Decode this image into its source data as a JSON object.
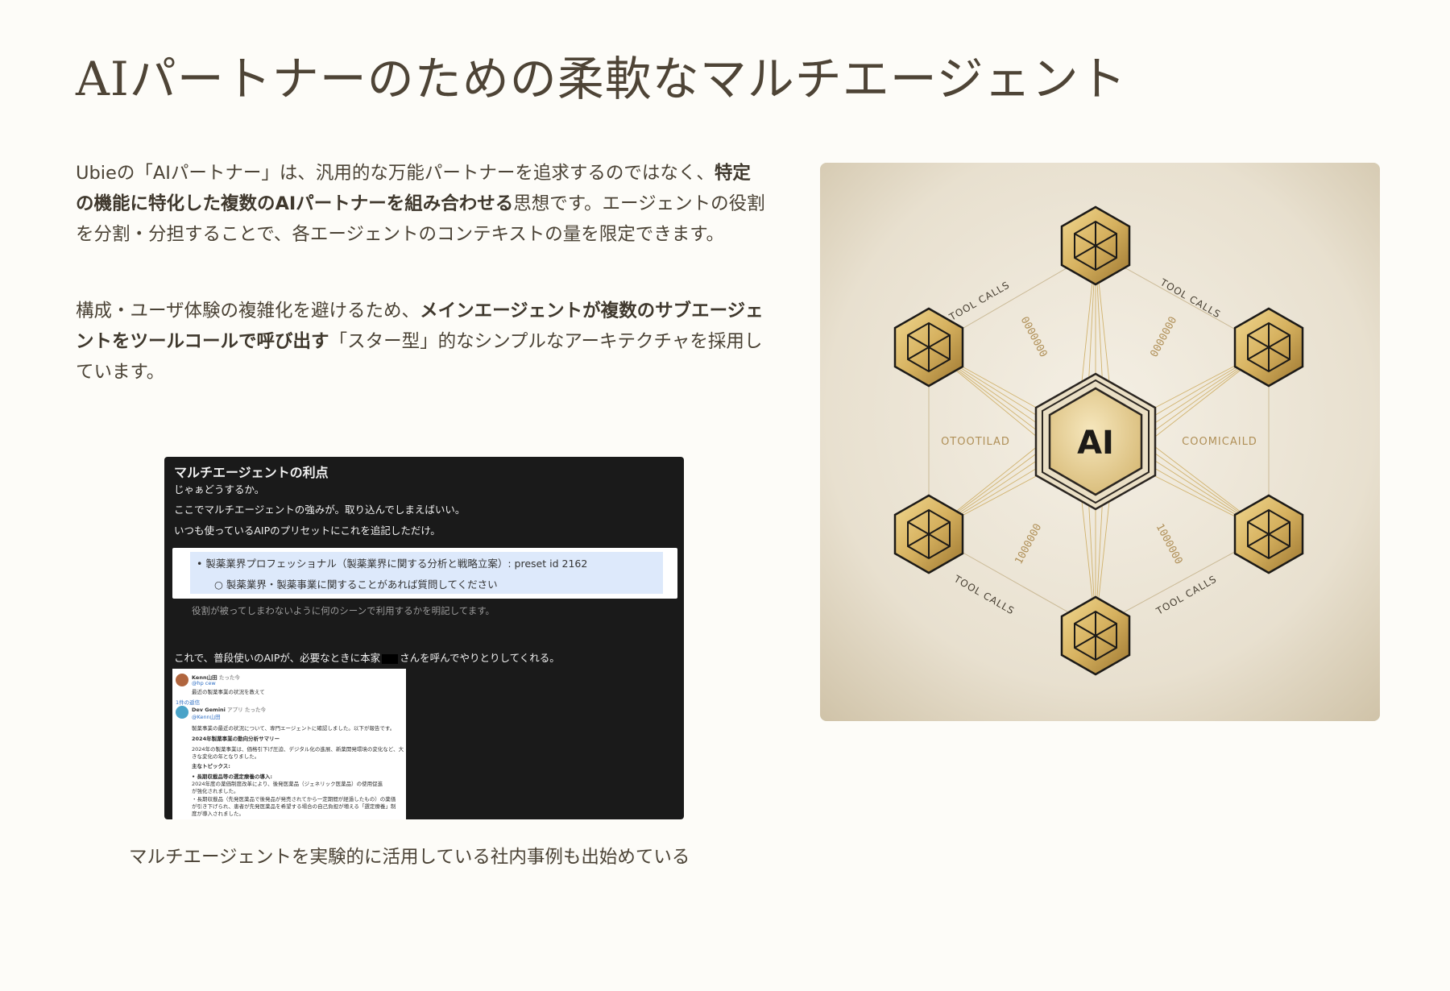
{
  "title": "AIパートナーのための柔軟なマルチエージェント",
  "paragraph1": {
    "t1": "Ubieの「AIパートナー」は、汎用的な万能パートナーを追求するのではなく、",
    "b1": "特定の機能に特化した複数のAIパートナーを組み合わせる",
    "t2": "思想です。エージェントの役割を分割・分担することで、各エージェントのコンテキストの量を限定できます。"
  },
  "paragraph2": {
    "t1": "構成・ユーザ体験の複雑化を避けるため、",
    "b1": "メインエージェントが複数のサブエージェントをツールコールで呼び出す",
    "t2": "「スター型」的なシンプルなアーキテクチャを採用しています。"
  },
  "screenshot": {
    "title": "マルチエージェントの利点",
    "line1": "じゃぁどうするか。",
    "line2": "ここでマルチエージェントの強みが。取り込んでしまえばいい。",
    "line3": "いつも使っているAIPのプリセットにこれを追記しただけ。",
    "bullet1": "製薬業界プロフェッショナル（製薬業界に関する分析と戦略立案）: preset id 2162",
    "bullet2": "製薬業界・製薬事業に関することがあれば質問してください",
    "note": "役割が被ってしまわないように何のシーンで利用するかを明記してます。",
    "line4a": "これで、普段使いのAIPが、必要なときに本家",
    "line4b": "さんを呼んでやりとりしてくれる。",
    "chat": {
      "user_name": "Kenn山田",
      "user_time": "たった今",
      "user_mention": "@hp cew",
      "user_msg": "最近の製薬事業の状況を教えて",
      "reply_count": "1件の返信",
      "bot_name": "Dev Gemini",
      "bot_tag": "アプリ",
      "bot_time": "たった今",
      "bot_mention": "@Kenn山田",
      "lines": [
        "製薬事業の最近の状況について、専門エージェントに確認しました。以下が報告です。",
        "2024年製薬事業の動向分析サマリー",
        "2024年の製薬事業は、価格引下げ圧迫、デジタル化の進展、新薬開発環境の変化など、大",
        "きな変化の年となりました。",
        "主なトピックス:",
        "• 長期収載品等の選定療養の導入:",
        "  2024年度の薬価制度改革により、後発医薬品（ジェネリック医薬品）の使用促進",
        "  が強化されました。",
        "  ・長期収載品（先発医薬品で後発品が発売されてから一定期間が経過したもの）の薬価",
        "  が引き下げられ、患者が先発医薬品を希望する場合の自己負担が増える「選定療養」制",
        "  度が導入されました。"
      ]
    }
  },
  "caption": "マルチエージェントを実験的に活用している社内事例も出始めている",
  "diagram": {
    "center_label": "AI",
    "tool_calls": "TOOL CALLS",
    "left_label": "OTOOTILAD",
    "right_label": "COOMICAILD",
    "bits_a": "0000000",
    "bits_b": "1000000"
  },
  "colors": {
    "background": "#fdfcf8",
    "text": "#4a4235",
    "gold": "#c9a552",
    "diagram_bg": "#e8e0d0"
  }
}
